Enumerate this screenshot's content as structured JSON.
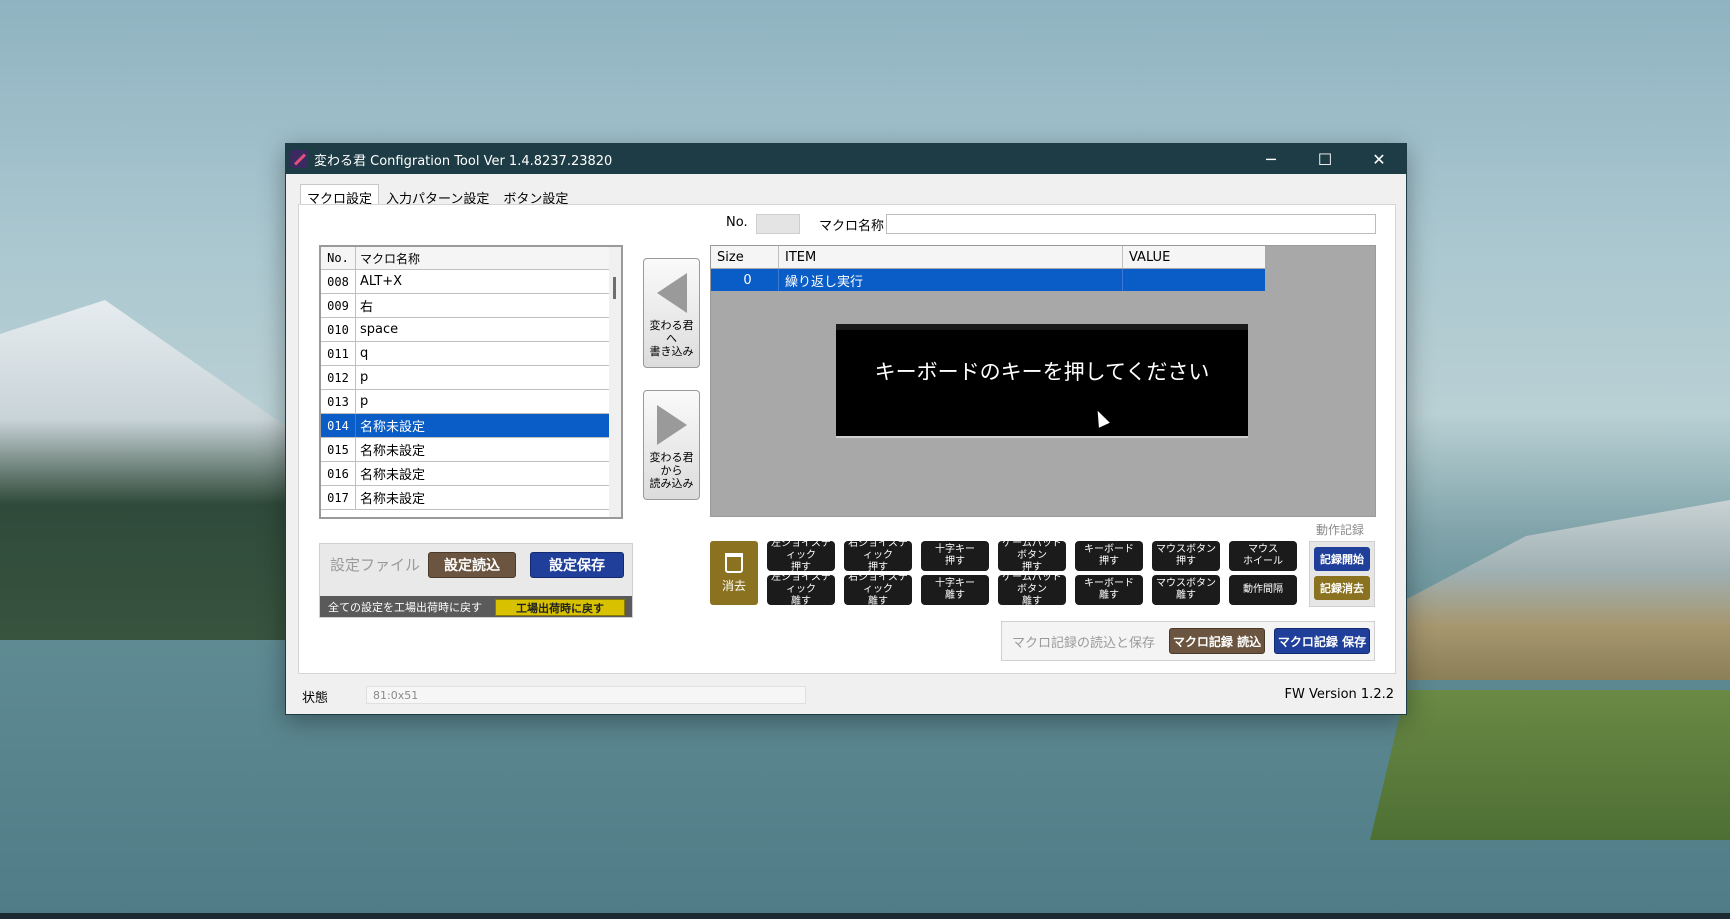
{
  "window": {
    "title": "変わる君 Configration Tool Ver 1.4.8237.23820",
    "controls": {
      "minimize": "─",
      "maximize": "☐",
      "close": "✕"
    }
  },
  "tabs": [
    "マクロ設定",
    "入力パターン設定",
    "ボタン設定"
  ],
  "macro_list": {
    "headers": {
      "no": "No.",
      "name": "マクロ名称"
    },
    "rows": [
      {
        "no": "008",
        "name": "ALT+X"
      },
      {
        "no": "009",
        "name": "右"
      },
      {
        "no": "010",
        "name": "space"
      },
      {
        "no": "011",
        "name": "q"
      },
      {
        "no": "012",
        "name": "p"
      },
      {
        "no": "013",
        "name": "p"
      },
      {
        "no": "014",
        "name": "名称未設定",
        "selected": true
      },
      {
        "no": "015",
        "name": "名称未設定"
      },
      {
        "no": "016",
        "name": "名称未設定"
      },
      {
        "no": "017",
        "name": "名称未設定"
      }
    ]
  },
  "transfer": {
    "write_to": "変わる君\nへ\n書き込み",
    "read_from": "変わる君\nから\n読み込み"
  },
  "settings_file": {
    "label": "設定ファイル",
    "load": "設定読込",
    "save": "設定保存",
    "reset_text": "全ての設定を工場出荷時に戻す",
    "reset_button": "工場出荷時に戻す"
  },
  "macro_header": {
    "no_label": "No.",
    "name_label": "マクロ名称",
    "name_value": ""
  },
  "macro_grid": {
    "headers": {
      "size": "Size",
      "item": "ITEM",
      "value": "VALUE"
    },
    "rows": [
      {
        "size": "0",
        "item": "繰り返し実行",
        "value": ""
      }
    ]
  },
  "overlay_message": "キーボードのキーを押してください",
  "actions": {
    "delete": "消去",
    "row1": [
      "左ジョイスティック\n押す",
      "右ジョイスティック\n押す",
      "十字キー\n押す",
      "ゲームパッドボタン\n押す",
      "キーボード\n押す",
      "マウスボタン\n押す",
      "マウス\nホイール"
    ],
    "row2": [
      "左ジョイスティック\n離す",
      "右ジョイスティック\n離す",
      "十字キー\n離す",
      "ゲームパッドボタン\n離す",
      "キーボード\n離す",
      "マウスボタン\n離す",
      "動作間隔"
    ]
  },
  "recording": {
    "label": "動作記録",
    "start": "記録開始",
    "clear": "記録消去"
  },
  "macro_record": {
    "label": "マクロ記録の読込と保存",
    "load": "マクロ記録 読込",
    "save": "マクロ記録 保存"
  },
  "status": {
    "label": "状態",
    "value": "81:0x51",
    "fw": "FW Version 1.2.2"
  },
  "colors": {
    "titlebar": "#1e3c45",
    "selection": "#0a5cc6",
    "brown": "#6b5540",
    "blue": "#1f3f9a",
    "yellow": "#d8c200",
    "gold": "#8a7220"
  }
}
